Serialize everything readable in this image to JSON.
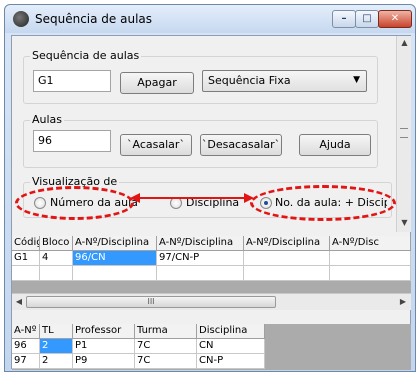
{
  "window": {
    "title": "Sequência de aulas",
    "icon": "app-icon",
    "controls": {
      "minimize": "–",
      "maximize": "□",
      "close": "✕"
    }
  },
  "sequence_group": {
    "label": "Sequência de aulas",
    "value": "G1",
    "delete_label": "Apagar",
    "mode_selected": "Sequência Fixa"
  },
  "lessons_group": {
    "label": "Aulas",
    "value": "96",
    "pair_label": "`Acasalar`",
    "unpair_label": "`Desacasalar`",
    "help_label": "Ajuda"
  },
  "view_group": {
    "label": "Visualização de",
    "options": [
      {
        "label": "Número da aula",
        "selected": false
      },
      {
        "label": "Disciplina",
        "selected": false
      },
      {
        "label": "No. da aula: + Disciplina",
        "selected": true
      }
    ]
  },
  "annotation_color": "#e31414",
  "sequence_table": {
    "headers": [
      "Códig",
      "Bloco",
      "A-Nº/Disciplina",
      "A-Nº/Disciplina",
      "A-Nº/Disciplina",
      "A-Nº/Disc"
    ],
    "rows": [
      [
        "G1",
        "4",
        "96/CN",
        "97/CN-P",
        "",
        ""
      ]
    ],
    "selected_cell": {
      "row": 0,
      "col": 2
    },
    "scroll_thumb_label": "III"
  },
  "lessons_table": {
    "headers": [
      "A-Nº",
      "TL",
      "Professor",
      "Turma",
      "Disciplina"
    ],
    "rows": [
      [
        "96",
        "2",
        "P1",
        "7C",
        "CN"
      ],
      [
        "97",
        "2",
        "P9",
        "7C",
        "CN-P"
      ]
    ]
  },
  "selection_color": "#3399ff"
}
